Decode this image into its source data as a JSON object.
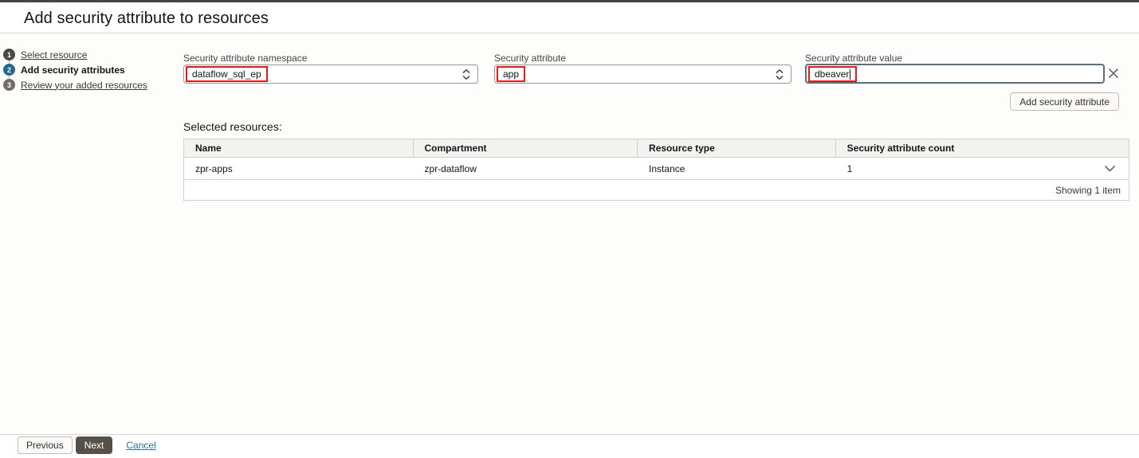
{
  "header": {
    "title": "Add security attribute to resources"
  },
  "wizard": {
    "steps": [
      {
        "number": "1",
        "label": "Select resource"
      },
      {
        "number": "2",
        "label": "Add security attributes"
      },
      {
        "number": "3",
        "label": "Review your added resources"
      }
    ]
  },
  "form": {
    "namespace": {
      "label": "Security attribute namespace",
      "value": "dataflow_sql_ep"
    },
    "attribute": {
      "label": "Security attribute",
      "value": "app"
    },
    "value": {
      "label": "Security attribute value",
      "value": "dbeaver"
    },
    "add_button_label": "Add security attribute"
  },
  "resources": {
    "heading": "Selected resources:",
    "table": {
      "columns": [
        "Name",
        "Compartment",
        "Resource type",
        "Security attribute count"
      ],
      "rows": [
        {
          "name": "zpr-apps",
          "compartment": "zpr-dataflow",
          "resource_type": "Instance",
          "security_attribute_count": "1"
        }
      ],
      "footer": "Showing 1 item"
    }
  },
  "footer_bar": {
    "previous": "Previous",
    "next": "Next",
    "cancel": "Cancel"
  },
  "colors": {
    "step_active": "#22698b",
    "annotation_red": "#de1b1b",
    "link_blue": "#2f6e99",
    "dark_button": "#575049"
  }
}
